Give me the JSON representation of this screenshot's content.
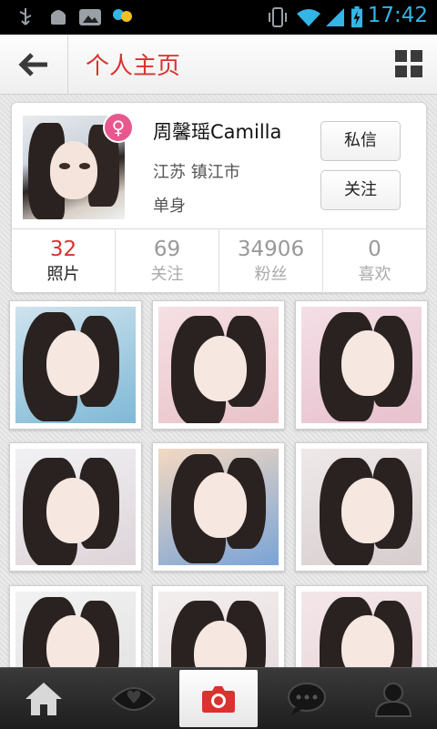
{
  "status_bar": {
    "time": "17:42",
    "icons": [
      "usb-icon",
      "android-debug-icon",
      "gallery-app-icon",
      "app-notification-icon",
      "vibrate-icon",
      "wifi-icon",
      "signal-icon",
      "battery-charging-icon"
    ]
  },
  "header": {
    "title": "个人主页",
    "back_icon": "back-arrow-icon",
    "menu_icon": "grid-menu-icon"
  },
  "profile": {
    "name": "周馨瑶Camilla",
    "location": "江苏 镇江市",
    "relationship": "单身",
    "gender_icon": "female-icon",
    "message_label": "私信",
    "follow_label": "关注"
  },
  "stats": [
    {
      "value": "32",
      "label": "照片"
    },
    {
      "value": "69",
      "label": "关注"
    },
    {
      "value": "34906",
      "label": "粉丝"
    },
    {
      "value": "0",
      "label": "喜欢"
    }
  ],
  "photo_count_visible": 9,
  "bottom_nav": [
    {
      "icon": "home-icon"
    },
    {
      "icon": "explore-eye-icon"
    },
    {
      "icon": "camera-icon"
    },
    {
      "icon": "messages-icon"
    },
    {
      "icon": "profile-icon"
    }
  ],
  "colors": {
    "accent": "#d9322f",
    "status_bar_text": "#33b5e5",
    "gender_badge": "#e8588f"
  }
}
